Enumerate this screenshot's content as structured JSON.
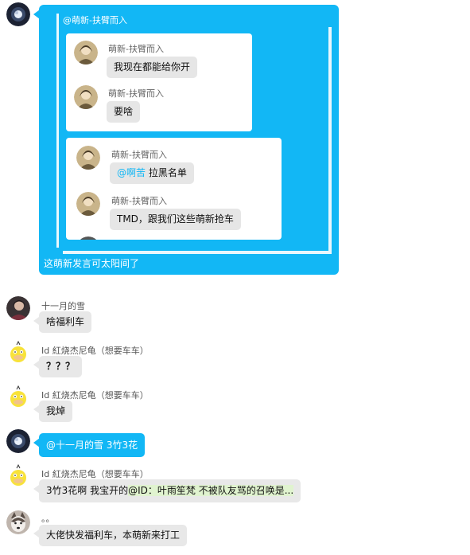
{
  "top_message": {
    "mention": "@萌新-扶臂而入",
    "quote_group_1": [
      {
        "sender": "萌新-扶臂而入",
        "text": "我现在都能给你开"
      },
      {
        "sender": "萌新-扶臂而入",
        "text": "要啥"
      }
    ],
    "quote_group_2": [
      {
        "sender": "萌新-扶臂而入",
        "mention": "@啊苦",
        "text": " 拉黑名单"
      },
      {
        "sender": "萌新-扶臂而入",
        "text": "TMD，跟我们这些萌新抢车"
      }
    ],
    "footer": "这萌新发言可太阳间了"
  },
  "messages": [
    {
      "sender": "十一月的雪",
      "text": "啥福利车"
    },
    {
      "sender": "Id 紅烧杰尼龟（想要车车）",
      "text": "？？？"
    },
    {
      "sender": "Id 紅烧杰尼龟（想要车车）",
      "text": "我焯"
    },
    {
      "sender": "",
      "mention": "@十一月的雪",
      "text": " 3竹3花"
    },
    {
      "sender": "Id 紅烧杰尼龟（想要车车）",
      "text_plain": "3竹3花啊 我宝开的",
      "text_highlight": "@ID：叶雨笙梵 不被队友骂的召唤是..."
    },
    {
      "sender": "。。",
      "text": "大佬快发福利车，本萌新来打工"
    }
  ],
  "colors": {
    "accent": "#12b7f5",
    "bubble_gray": "#e8e8e8",
    "highlight": "#e0f3cf"
  },
  "icons": {
    "self_avatar": "dark-moon-avatar",
    "duck_avatar": "psyduck-avatar",
    "dog_avatar": "husky-avatar",
    "portrait_avatar": "portrait-avatar"
  }
}
